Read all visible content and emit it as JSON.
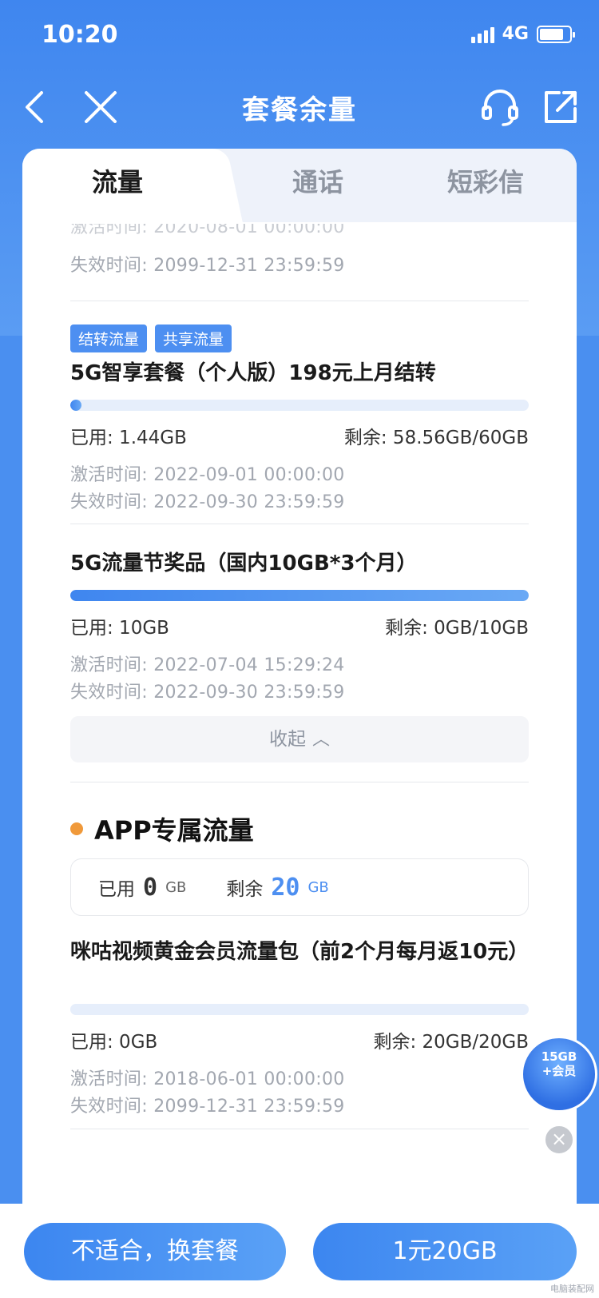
{
  "status": {
    "time": "10:20",
    "network": "4G"
  },
  "nav": {
    "title": "套餐余量"
  },
  "tabs": [
    "流量",
    "通话",
    "短彩信"
  ],
  "top_partial": {
    "expire": "失效时间: 2099-12-31 23:59:59"
  },
  "packages": [
    {
      "tags": [
        "结转流量",
        "共享流量"
      ],
      "name": "5G智享套餐（个人版）198元上月结转",
      "used": "已用: 1.44GB",
      "remain": "剩余: 58.56GB/60GB",
      "usage_fraction": 0.024,
      "activate": "激活时间: 2022-09-01 00:00:00",
      "expire": "失效时间: 2022-09-30 23:59:59"
    },
    {
      "name": "5G流量节奖品（国内10GB*3个月）",
      "used": "已用: 10GB",
      "remain": "剩余: 0GB/10GB",
      "usage_fraction": 1.0,
      "activate": "激活时间: 2022-07-04 15:29:24",
      "expire": "失效时间: 2022-09-30 23:59:59"
    }
  ],
  "collapse_label": "收起",
  "app_section": {
    "title": "APP专属流量",
    "used_label": "已用",
    "used_value": "0",
    "used_unit": "GB",
    "remain_label": "剩余",
    "remain_value": "20",
    "remain_unit": "GB",
    "package": {
      "name": "咪咕视频黄金会员流量包（前2个月每月返10元）",
      "used": "已用: 0GB",
      "remain": "剩余: 20GB/20GB",
      "usage_fraction": 0.0,
      "activate": "激活时间: 2018-06-01 00:00:00",
      "expire": "失效时间: 2099-12-31 23:59:59"
    }
  },
  "promo": {
    "line1": "15GB",
    "line2": "+会员"
  },
  "buttons": {
    "change": "不适合，换套餐",
    "buy": "1元20GB"
  },
  "watermark": "电脑装配网",
  "colors": {
    "primary": "#3f86ef",
    "accent_dot": "#f0993a",
    "tag_bg": "#4d8ff1"
  }
}
